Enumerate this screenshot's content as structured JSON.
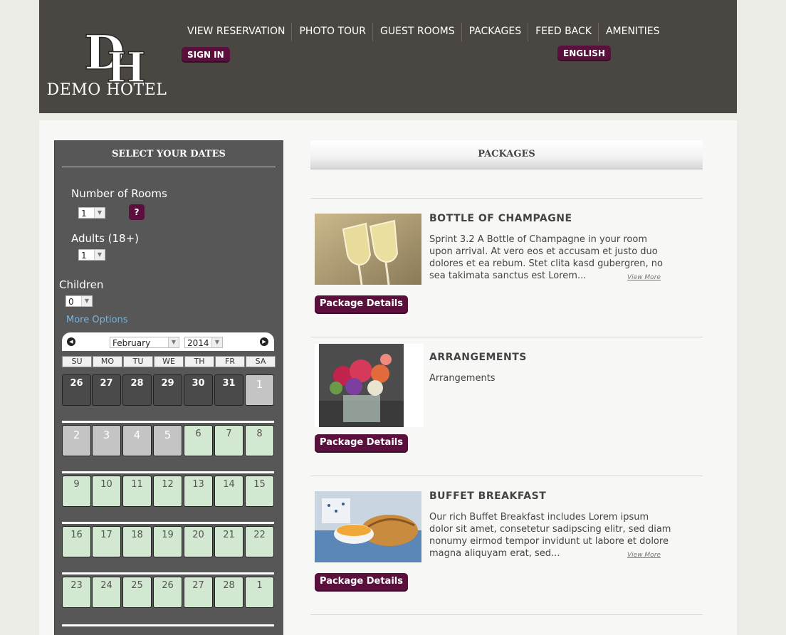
{
  "header": {
    "logo_initials": "DH",
    "logo_name": "DEMO HOTEL",
    "nav": [
      "VIEW RESERVATION",
      "PHOTO TOUR",
      "GUEST ROOMS",
      "PACKAGES",
      "FEED BACK",
      "AMENITIES"
    ],
    "sign_in": "SIGN IN",
    "language": "ENGLISH"
  },
  "sidebar": {
    "title": "SELECT YOUR DATES",
    "rooms_label": "Number of Rooms",
    "rooms_value": "1",
    "help": "?",
    "adults_label": "Adults (18+)",
    "adults_value": "1",
    "children_label": "Children",
    "children_value": "0",
    "more_options": "More Options",
    "calendar": {
      "month": "February",
      "year": "2014",
      "days_of_week": [
        "SU",
        "MO",
        "TU",
        "WE",
        "TH",
        "FR",
        "SA"
      ],
      "weeks": [
        [
          "26",
          "27",
          "28",
          "29",
          "30",
          "31",
          "1"
        ],
        [
          "2",
          "3",
          "4",
          "5",
          "6",
          "7",
          "8"
        ],
        [
          "9",
          "10",
          "11",
          "12",
          "13",
          "14",
          "15"
        ],
        [
          "16",
          "17",
          "18",
          "19",
          "20",
          "21",
          "22"
        ],
        [
          "23",
          "24",
          "25",
          "26",
          "27",
          "28",
          "1"
        ]
      ]
    }
  },
  "main": {
    "title": "PACKAGES",
    "packages": [
      {
        "title": "BOTTLE OF CHAMPAGNE",
        "description": "Sprint 3.2 A Bottle of Champagne in your room upon arrival. At vero eos et accusam et justo duo dolores et ea rebum. Stet clita kasd gubergren, no sea takimata sanctus est Lorem...",
        "view_more": "View More",
        "button": "Package Details"
      },
      {
        "title": "ARRANGEMENTS",
        "description": "Arrangements",
        "button": "Package Details"
      },
      {
        "title": "BUFFET BREAKFAST",
        "description": "Our rich Buffet Breakfast includes Lorem ipsum dolor sit amet, consetetur sadipscing elitr, sed diam nonumy eirmod tempor invidunt ut labore et dolore magna aliquyam erat, sed...",
        "view_more": "View More",
        "button": "Package Details"
      }
    ]
  },
  "colors": {
    "header_bg": "#4a4642",
    "accent": "#5a0f3c",
    "sidebar_bg": "#575757",
    "available_day": "#d3e8d0"
  }
}
